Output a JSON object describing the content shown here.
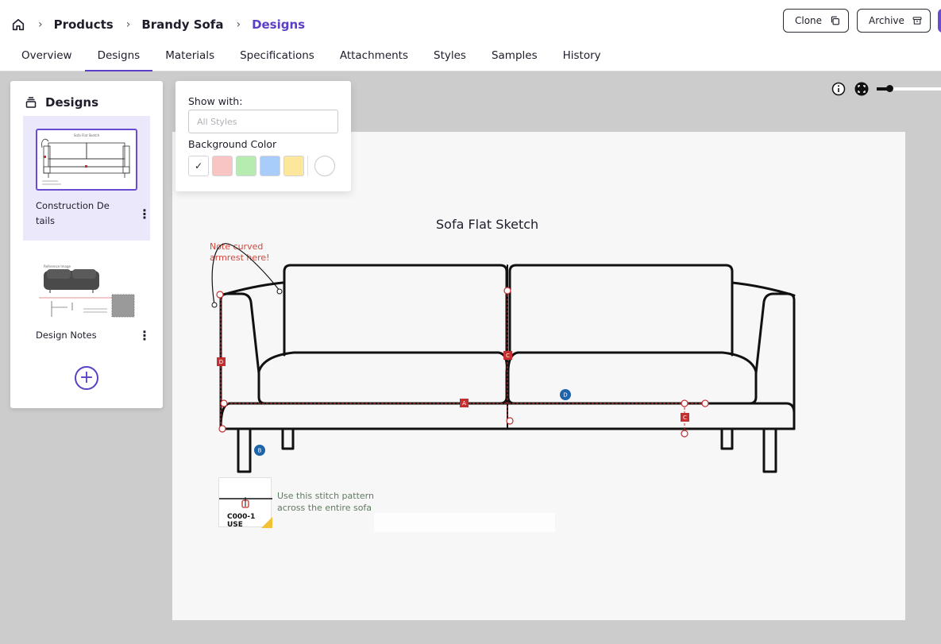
{
  "header": {
    "breadcrumbs": [
      "Products",
      "Brandy Sofa",
      "Designs"
    ],
    "clone_label": "Clone",
    "archive_label": "Archive"
  },
  "tabs": [
    {
      "label": "Overview",
      "active": false
    },
    {
      "label": "Designs",
      "active": true
    },
    {
      "label": "Materials",
      "active": false
    },
    {
      "label": "Specifications",
      "active": false
    },
    {
      "label": "Attachments",
      "active": false
    },
    {
      "label": "Styles",
      "active": false
    },
    {
      "label": "Samples",
      "active": false
    },
    {
      "label": "History",
      "active": false
    }
  ],
  "designs_panel": {
    "title": "Designs",
    "items": [
      {
        "label_line1": "Construction De",
        "label_line2": "tails",
        "selected": true,
        "thumb_title": "Sofa Flat Sketch"
      },
      {
        "label_line1": "Design Notes",
        "selected": false,
        "thumb_title": "Reference Image"
      }
    ]
  },
  "popover": {
    "show_with_label": "Show with:",
    "styles_placeholder": "All Styles",
    "bg_color_label": "Background Color",
    "swatches": [
      "#ffffff",
      "#f9c4c4",
      "#b6ecb0",
      "#a9cdfa",
      "#fde79c"
    ],
    "selected_swatch_mark": "✓"
  },
  "canvas": {
    "title": "Sofa Flat Sketch",
    "note_line1": "Note curved",
    "note_line2": "armrest here!",
    "stitch_line1": "Use this stitch pattern",
    "stitch_line2": "across the entire sofa",
    "stitch_code": "C000-1 USE",
    "markers": {
      "a": "A",
      "b": "B",
      "c": "C",
      "d": "D"
    }
  },
  "colors": {
    "accent": "#5b3fc4",
    "marker_red": "#c62f2f",
    "marker_blue": "#1f63a8",
    "note_red": "#d2473d"
  }
}
